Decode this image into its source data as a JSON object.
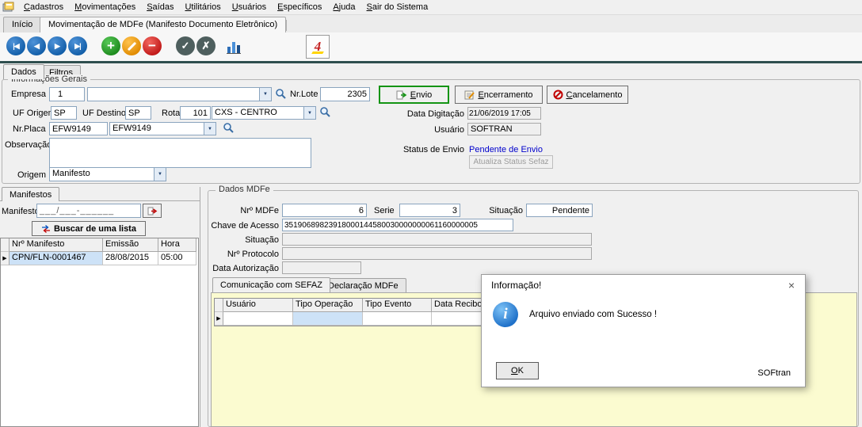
{
  "colors": {
    "accent_green": "#149414",
    "status_blue": "#0000cc",
    "panel_yellow": "#fbfbd0",
    "selection_blue": "#cde2f7"
  },
  "menubar": {
    "items": [
      "Cadastros",
      "Movimentações",
      "Saídas",
      "Utilitários",
      "Usuários",
      "Específicos",
      "Ajuda",
      "Sair do Sistema"
    ]
  },
  "tabstrip": {
    "inicio": "Início",
    "mdfe": "Movimentação de MDFe (Manifesto Documento Eletrônico)"
  },
  "page_tabs": {
    "dados": "Dados",
    "filtros": "Filtros"
  },
  "info": {
    "title": "Informações Gerais",
    "empresa": {
      "label": "Empresa",
      "value": "1",
      "nome": ""
    },
    "nrlote": {
      "label": "Nr.Lote",
      "value": "2305"
    },
    "buttons": {
      "envio": "Envio",
      "encerramento": "Encerramento",
      "cancelamento": "Cancelamento",
      "atualiza": "Atualiza Status Sefaz"
    },
    "uf_origem": {
      "label": "UF Origem",
      "value": "SP"
    },
    "uf_destino": {
      "label": "UF Destino",
      "value": "SP"
    },
    "rota": {
      "label": "Rota",
      "value": "101",
      "nome": "CXS - CENTRO"
    },
    "data_digitacao": {
      "label": "Data Digitação",
      "value": "21/06/2019 17:05"
    },
    "nrplaca": {
      "label": "Nr.Placa",
      "value": "EFW9149",
      "combo": "EFW9149"
    },
    "usuario": {
      "label": "Usuário",
      "value": "SOFTRAN"
    },
    "observacao": {
      "label": "Observação",
      "value": ""
    },
    "status_envio": {
      "label": "Status de Envio",
      "value": "Pendente de Envio"
    },
    "origem": {
      "label": "Origem",
      "value": "Manifesto"
    }
  },
  "manifestos": {
    "tab": "Manifestos",
    "label": "Manifesto",
    "mask": "___/___-______",
    "buscar": "Buscar de uma lista",
    "headers": [
      "Nrº Manifesto",
      "Emissão",
      "Hora"
    ],
    "row": {
      "numero": "CPN/FLN-0001467",
      "emissao": "28/08/2015",
      "hora": "05:00"
    }
  },
  "mdfe": {
    "title": "Dados MDFe",
    "nr": {
      "label": "Nrº MDFe",
      "value": "6"
    },
    "serie": {
      "label": "Serie",
      "value": "3"
    },
    "situacao": {
      "label": "Situação",
      "value": "Pendente"
    },
    "chave": {
      "label": "Chave de Acesso",
      "value": "35190689823918000144580030000000061160000005"
    },
    "situacao2": {
      "label": "Situação",
      "value": ""
    },
    "protocolo": {
      "label": "Nrº Protocolo",
      "value": ""
    },
    "data_autorizacao": {
      "label": "Data Autorização",
      "value": ""
    },
    "tabs": {
      "comunicacao": "Comunicação com SEFAZ",
      "declaracao": "Declaração MDFe"
    },
    "headers": [
      "Usuário",
      "Tipo Operação",
      "Tipo Evento",
      "Data Recibo"
    ]
  },
  "dialog": {
    "title": "Informação!",
    "message": "Arquivo enviado com Sucesso !",
    "ok": "OK",
    "brand": "SOFtran"
  }
}
